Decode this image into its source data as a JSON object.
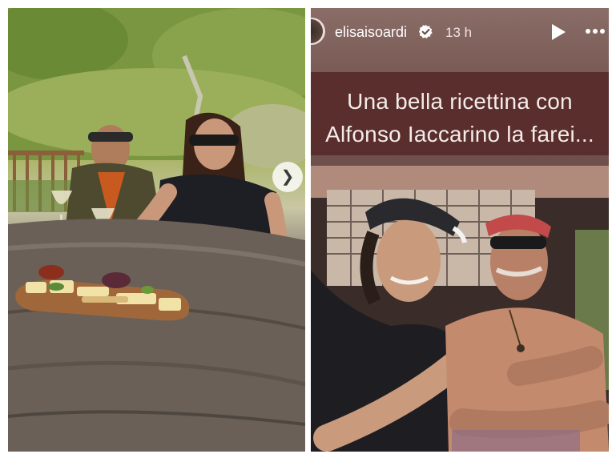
{
  "left_post": {
    "image_description_icon": "photo-two-people-wine-table",
    "next_button_glyph": "❯"
  },
  "story": {
    "username": "elisaisoardi",
    "time_ago": "13 h",
    "caption_line_1": "Una bella ricettina con",
    "caption_line_2": "Alfonso Iaccarino la farei...",
    "colors": {
      "caption_band": "#5a2e2c",
      "caption_text": "#f3ecea"
    }
  }
}
